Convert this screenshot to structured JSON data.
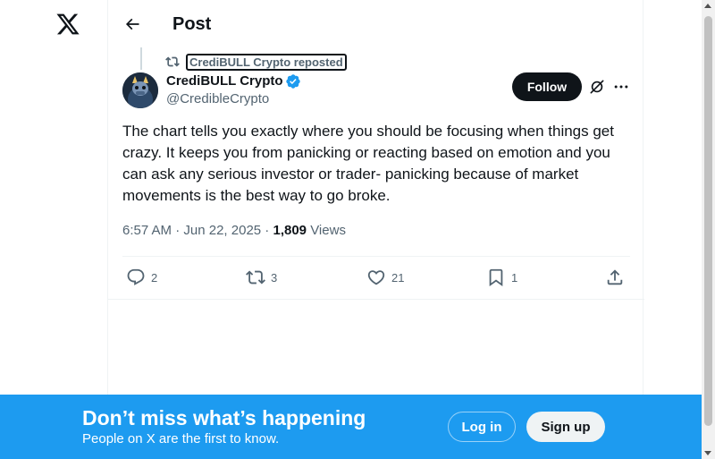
{
  "brand": {
    "logo_icon": "x-logo-icon",
    "accent": "#1d9bf0"
  },
  "header": {
    "title": "Post",
    "back_icon": "arrow-left-icon"
  },
  "repost": {
    "label": "CrediBULL Crypto reposted",
    "icon": "repost-icon"
  },
  "author": {
    "display_name": "CrediBULL Crypto",
    "handle": "@CredibleCrypto",
    "verified": true,
    "follow_label": "Follow"
  },
  "post": {
    "text": "The chart tells you exactly where you should be focusing when things get crazy. It keeps you from panicking or reacting based on emotion and you can ask any serious investor or trader- panicking because of market movements is the best way to go broke.",
    "time": "6:57 AM",
    "date": "Jun 22, 2025",
    "views_count": "1,809",
    "views_label": "Views"
  },
  "actions": {
    "replies": "2",
    "reposts": "3",
    "likes": "21",
    "bookmarks": "1"
  },
  "bottom_bar": {
    "title": "Don’t miss what’s happening",
    "subtitle": "People on X are the first to know.",
    "login_label": "Log in",
    "signup_label": "Sign up"
  }
}
